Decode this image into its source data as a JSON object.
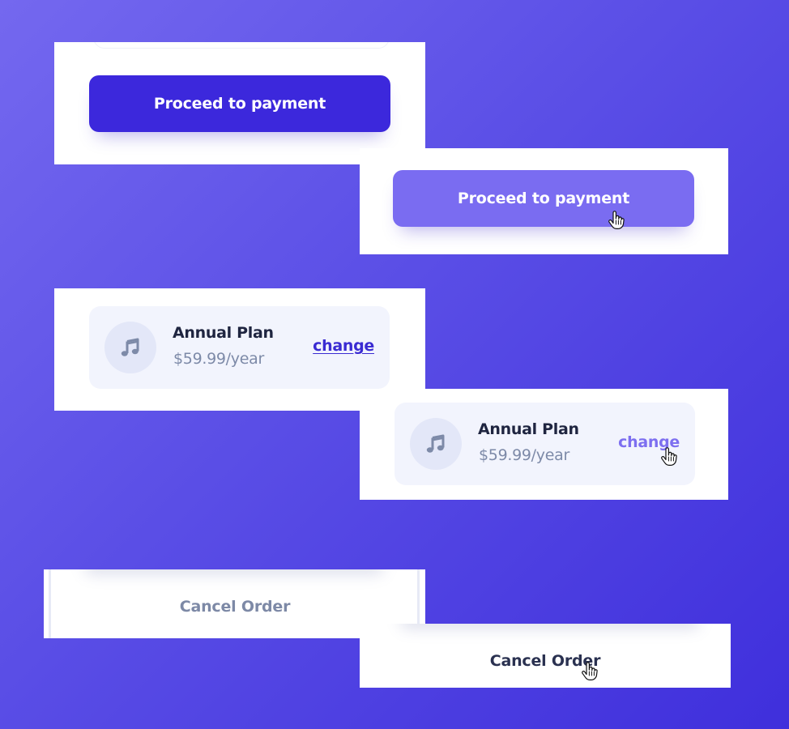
{
  "colors": {
    "primary": "#3c28dc",
    "primary_hover": "#7a6cf1",
    "text_dark": "#1f2540",
    "text_muted": "#7d8aa8",
    "card_bg": "#f2f4fd",
    "background_gradient": [
      "#7468ef",
      "#3f2fdc"
    ]
  },
  "states": {
    "proceed_default": {
      "button_label": "Proceed to payment"
    },
    "proceed_hover": {
      "button_label": "Proceed to payment",
      "cursor_icon": "hand-pointer-icon"
    },
    "plan_default": {
      "icon": "music-note-icon",
      "plan_name": "Annual Plan",
      "plan_price": "$59.99/year",
      "change_label": "change"
    },
    "plan_hover": {
      "icon": "music-note-icon",
      "plan_name": "Annual Plan",
      "plan_price": "$59.99/year",
      "change_label": "change",
      "cursor_icon": "hand-pointer-icon"
    },
    "cancel_default": {
      "button_label": "Cancel Order"
    },
    "cancel_hover": {
      "button_label": "Cancel Order",
      "cursor_icon": "hand-pointer-icon"
    }
  }
}
